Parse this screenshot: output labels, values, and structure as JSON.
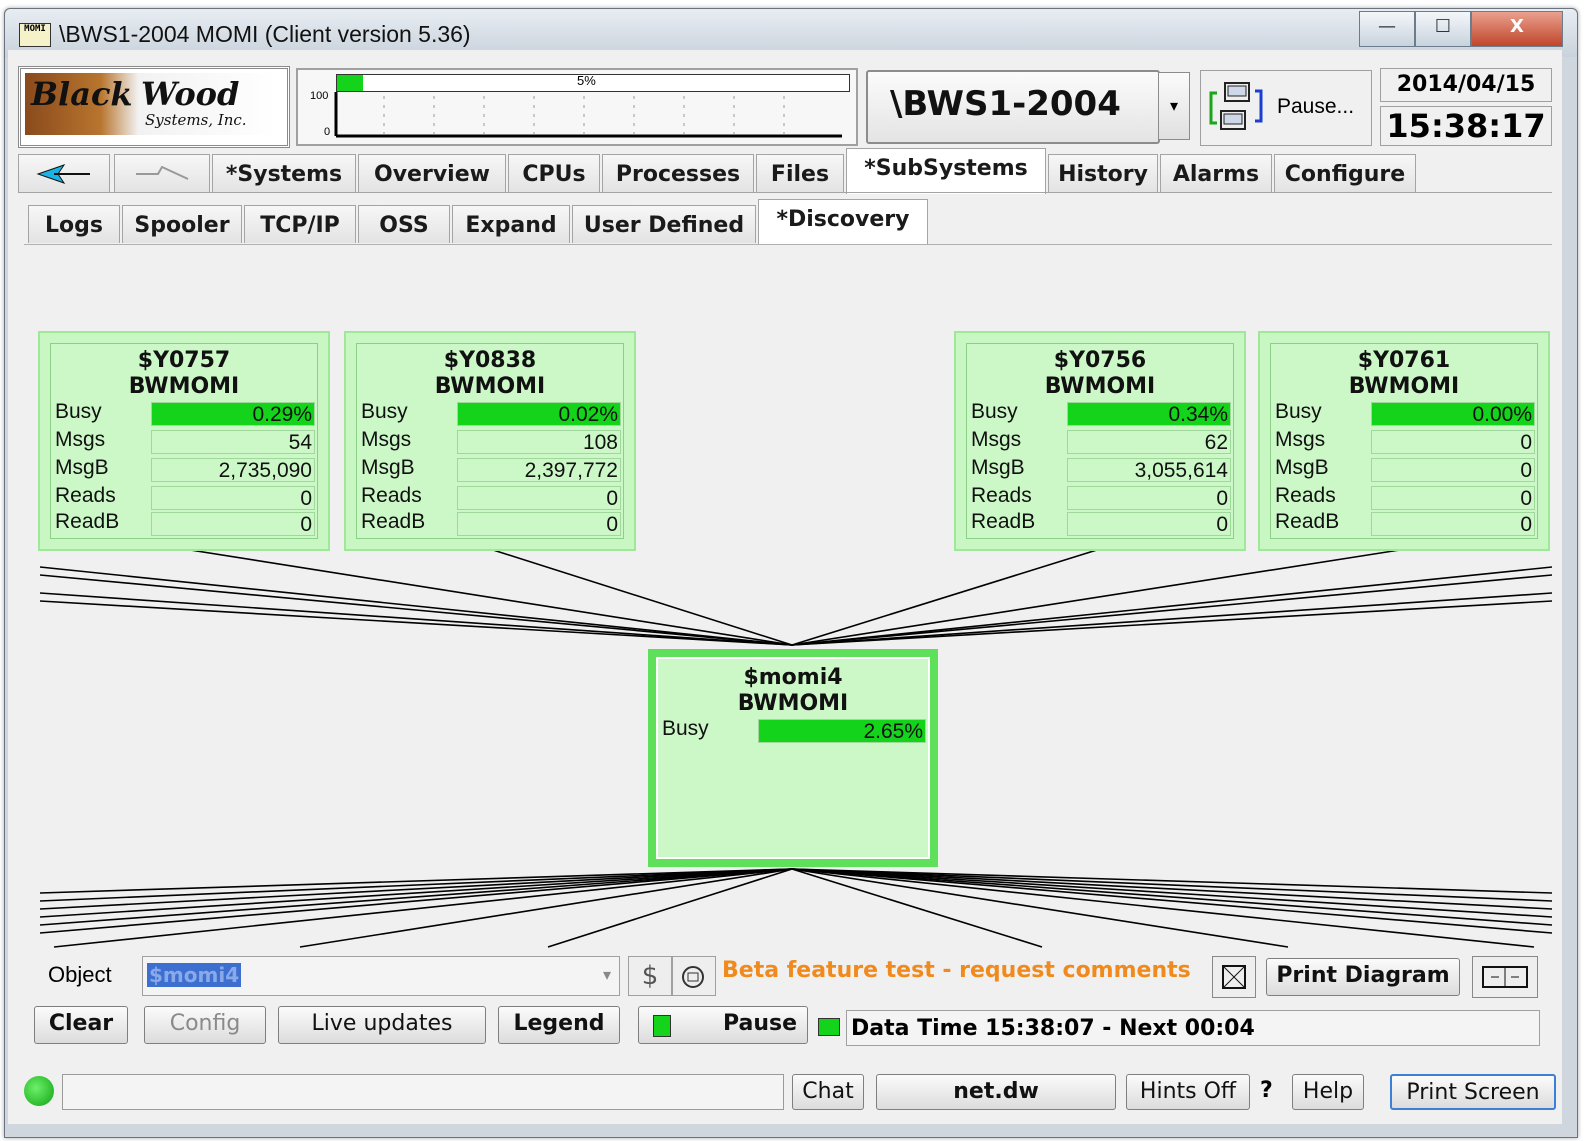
{
  "window": {
    "title": "\\BWS1-2004 MOMI (Client version 5.36)",
    "icon_text": "MOMI",
    "controls": {
      "minimize": "—",
      "maximize": "☐",
      "close": "X"
    }
  },
  "logo": {
    "word1": "Black",
    "word2": "Wood",
    "sub": "Systems, Inc."
  },
  "gauge": {
    "percent_label": "5%",
    "percent": 5,
    "ymax": "100",
    "ymin": "0"
  },
  "system": {
    "name": "\\BWS1-2004",
    "dropdown_arrow": "▾",
    "pause_label": "Pause..."
  },
  "datetime": {
    "date": "2014/04/15",
    "time": "15:38:17"
  },
  "main_tabs": [
    "*Systems",
    "Overview",
    "CPUs",
    "Processes",
    "Files",
    "*SubSystems",
    "History",
    "Alarms",
    "Configure"
  ],
  "sub_tabs": [
    "Logs",
    "Spooler",
    "TCP/IP",
    "OSS",
    "Expand",
    "User Defined",
    "*Discovery"
  ],
  "metric_labels": {
    "busy": "Busy",
    "msgs": "Msgs",
    "msgb": "MsgB",
    "reads": "Reads",
    "readb": "ReadB"
  },
  "nodes": [
    {
      "name": "$Y0757",
      "type": "BWMOMI",
      "busy": "0.29%",
      "msgs": "54",
      "msgb": "2,735,090",
      "reads": "0",
      "readb": "0"
    },
    {
      "name": "$Y0838",
      "type": "BWMOMI",
      "busy": "0.02%",
      "msgs": "108",
      "msgb": "2,397,772",
      "reads": "0",
      "readb": "0"
    },
    {
      "name": "$Y0756",
      "type": "BWMOMI",
      "busy": "0.34%",
      "msgs": "62",
      "msgb": "3,055,614",
      "reads": "0",
      "readb": "0"
    },
    {
      "name": "$Y0761",
      "type": "BWMOMI",
      "busy": "0.00%",
      "msgs": "0",
      "msgb": "0",
      "reads": "0",
      "readb": "0"
    }
  ],
  "center_node": {
    "name": "$momi4",
    "type": "BWMOMI",
    "busy": "2.65%"
  },
  "object_bar": {
    "label": "Object",
    "value": "$momi4",
    "beta_text": "Beta feature test - request comments",
    "print_diagram": "Print Diagram",
    "colors": {
      "beta": "#f08a1c",
      "busy_green": "#13d41a",
      "node_fill": "#ccf8c8"
    }
  },
  "buttons": {
    "clear": "Clear",
    "config": "Config",
    "live_updates": "Live updates",
    "legend": "Legend",
    "pause": "Pause",
    "data_time": "Data Time 15:38:07 - Next 00:04"
  },
  "status_bar": {
    "chat": "Chat",
    "file": "net.dw",
    "hints": "Hints Off",
    "question": "?",
    "help": "Help",
    "print_screen": "Print Screen"
  }
}
